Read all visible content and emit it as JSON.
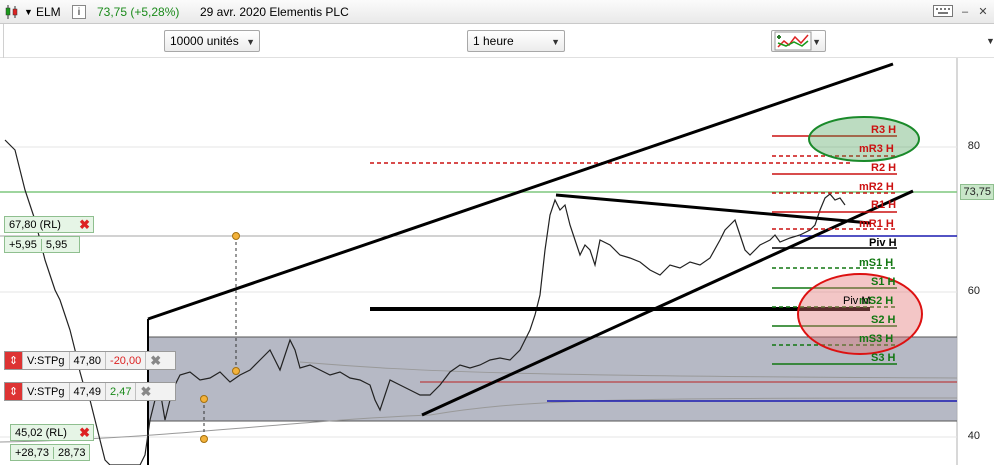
{
  "titlebar": {
    "ticker": "ELM",
    "info_icon": "i",
    "price_change": "73,75 (+5,28%)",
    "date_name": "29 avr. 2020 Elementis PLC"
  },
  "toolbar": {
    "quantity": "10000 unités",
    "timeframe": "1 heure"
  },
  "price_axis": {
    "labels": [
      "80",
      "73,75",
      "60",
      "40"
    ]
  },
  "price_tags": {
    "tag1_value": "67,80 (RL)",
    "tag1_diff": "+5,95",
    "tag1_diff2": "5,95",
    "tag2_value": "45,02 (RL)",
    "tag2_diff": "+28,73",
    "tag2_diff2": "28,73"
  },
  "orders": {
    "order1_label": "V:STPg",
    "order1_price": "47,80",
    "order1_pl": "-20,00",
    "order2_label": "V:STPg",
    "order2_price": "47,49",
    "order2_pl": "2,47"
  },
  "pivots": {
    "r3": "R3 H",
    "mr3": "mR3 H",
    "r2": "R2 H",
    "mr2": "mR2 H",
    "r1": "R1 H",
    "mr1": "mR1 H",
    "piv": "Piv H",
    "ms1": "mS1 H",
    "s1": "S1 H",
    "ms2": "mS2 H",
    "s2": "S2 H",
    "ms3": "mS3 H",
    "s3": "S3 H",
    "pivm": "Piv M"
  },
  "colors": {
    "resistance": "#cc1111",
    "support": "#117711",
    "pivot": "#000000",
    "axis_current": "#c8e6c8"
  }
}
